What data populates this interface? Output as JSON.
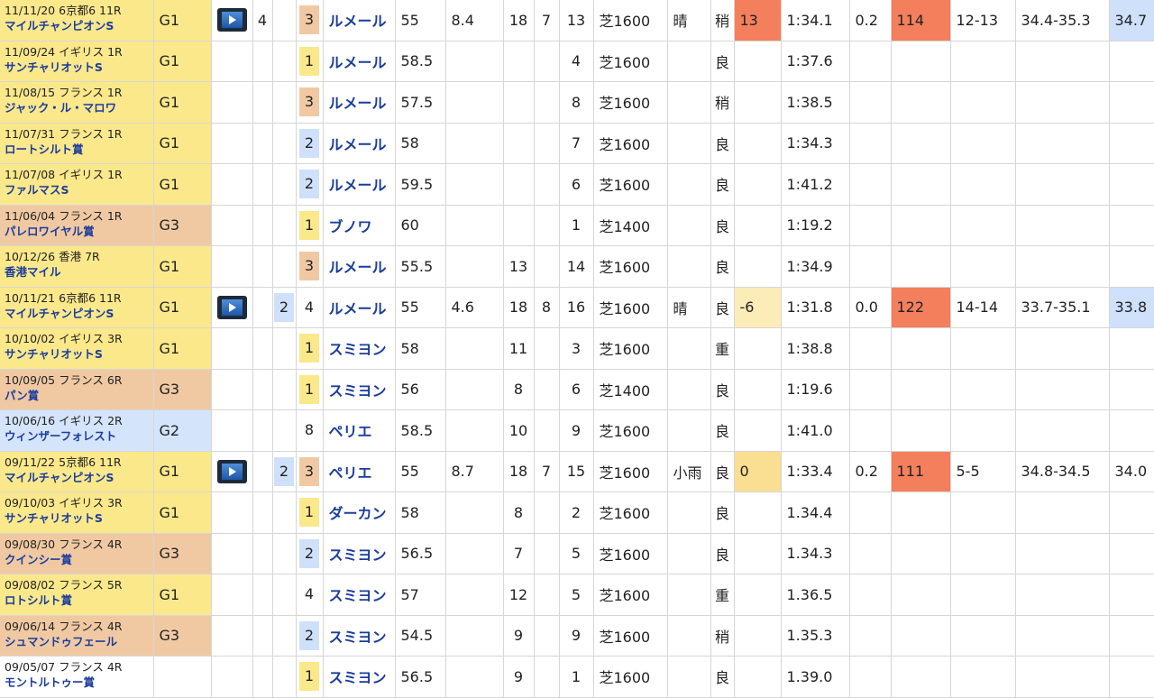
{
  "rows": [
    {
      "date": "11/11/20 6京都6 11R",
      "race": "マイルチャンピオンS",
      "grade": "G1",
      "grade_cls": "g1",
      "video": true,
      "gate": "4",
      "waku": "",
      "place": "3",
      "place_cls": "b3",
      "jockey": "ルメール",
      "weight": "55",
      "odds": "8.4",
      "field": "18",
      "pop": "7",
      "horse": "13",
      "course": "芝1600",
      "weather": "晴",
      "track": "稍",
      "diff": "13",
      "diff_cls": "diff-o",
      "time": "1:34.1",
      "margin": "0.2",
      "speed": "114",
      "pos": "12-13",
      "pace": "34.4-35.3",
      "last": "34.7",
      "last_cls": "last-b"
    },
    {
      "date": "11/09/24 イギリス 1R",
      "race": "サンチャリオットS",
      "grade": "G1",
      "grade_cls": "g1",
      "video": false,
      "gate": "",
      "waku": "",
      "place": "1",
      "place_cls": "b1",
      "jockey": "ルメール",
      "weight": "58.5",
      "odds": "",
      "field": "",
      "pop": "",
      "horse": "4",
      "course": "芝1600",
      "weather": "",
      "track": "良",
      "diff": "",
      "diff_cls": "",
      "time": "1:37.6",
      "margin": "",
      "speed": "",
      "pos": "",
      "pace": "",
      "last": "",
      "last_cls": ""
    },
    {
      "date": "11/08/15 フランス 1R",
      "race": "ジャック・ル・マロワ",
      "grade": "G1",
      "grade_cls": "g1",
      "video": false,
      "gate": "",
      "waku": "",
      "place": "3",
      "place_cls": "b3",
      "jockey": "ルメール",
      "weight": "57.5",
      "odds": "",
      "field": "",
      "pop": "",
      "horse": "8",
      "course": "芝1600",
      "weather": "",
      "track": "稍",
      "diff": "",
      "diff_cls": "",
      "time": "1:38.5",
      "margin": "",
      "speed": "",
      "pos": "",
      "pace": "",
      "last": "",
      "last_cls": ""
    },
    {
      "date": "11/07/31 フランス 1R",
      "race": "ロートシルト賞",
      "grade": "G1",
      "grade_cls": "g1",
      "video": false,
      "gate": "",
      "waku": "",
      "place": "2",
      "place_cls": "b2",
      "jockey": "ルメール",
      "weight": "58",
      "odds": "",
      "field": "",
      "pop": "",
      "horse": "7",
      "course": "芝1600",
      "weather": "",
      "track": "良",
      "diff": "",
      "diff_cls": "",
      "time": "1:34.3",
      "margin": "",
      "speed": "",
      "pos": "",
      "pace": "",
      "last": "",
      "last_cls": ""
    },
    {
      "date": "11/07/08 イギリス 1R",
      "race": "ファルマスS",
      "grade": "G1",
      "grade_cls": "g1",
      "video": false,
      "gate": "",
      "waku": "",
      "place": "2",
      "place_cls": "b2",
      "jockey": "ルメール",
      "weight": "59.5",
      "odds": "",
      "field": "",
      "pop": "",
      "horse": "6",
      "course": "芝1600",
      "weather": "",
      "track": "良",
      "diff": "",
      "diff_cls": "",
      "time": "1:41.2",
      "margin": "",
      "speed": "",
      "pos": "",
      "pace": "",
      "last": "",
      "last_cls": ""
    },
    {
      "date": "11/06/04 フランス 1R",
      "race": "パレロワイヤル賞",
      "grade": "G3",
      "grade_cls": "g3",
      "video": false,
      "gate": "",
      "waku": "",
      "place": "1",
      "place_cls": "b1",
      "jockey": "ブノワ",
      "weight": "60",
      "odds": "",
      "field": "",
      "pop": "",
      "horse": "1",
      "course": "芝1400",
      "weather": "",
      "track": "良",
      "diff": "",
      "diff_cls": "",
      "time": "1:19.2",
      "margin": "",
      "speed": "",
      "pos": "",
      "pace": "",
      "last": "",
      "last_cls": ""
    },
    {
      "date": "10/12/26 香港 7R",
      "race": "香港マイル",
      "grade": "G1",
      "grade_cls": "g1",
      "video": false,
      "gate": "",
      "waku": "",
      "place": "3",
      "place_cls": "b3",
      "jockey": "ルメール",
      "weight": "55.5",
      "odds": "",
      "field": "13",
      "pop": "",
      "horse": "14",
      "course": "芝1600",
      "weather": "",
      "track": "良",
      "diff": "",
      "diff_cls": "",
      "time": "1:34.9",
      "margin": "",
      "speed": "",
      "pos": "",
      "pace": "",
      "last": "",
      "last_cls": ""
    },
    {
      "date": "10/11/21 6京都6 11R",
      "race": "マイルチャンピオンS",
      "grade": "G1",
      "grade_cls": "g1",
      "video": true,
      "gate": "",
      "waku": "2",
      "place": "4",
      "place_cls": "",
      "jockey": "ルメール",
      "weight": "55",
      "odds": "4.6",
      "field": "18",
      "pop": "8",
      "horse": "16",
      "course": "芝1600",
      "weather": "晴",
      "track": "良",
      "diff": "-6",
      "diff_cls": "diff-y",
      "time": "1:31.8",
      "margin": "0.0",
      "speed": "122",
      "pos": "14-14",
      "pace": "33.7-35.1",
      "last": "33.8",
      "last_cls": "last-b"
    },
    {
      "date": "10/10/02 イギリス 3R",
      "race": "サンチャリオットS",
      "grade": "G1",
      "grade_cls": "g1",
      "video": false,
      "gate": "",
      "waku": "",
      "place": "1",
      "place_cls": "b1",
      "jockey": "スミヨン",
      "weight": "58",
      "odds": "",
      "field": "11",
      "pop": "",
      "horse": "3",
      "course": "芝1600",
      "weather": "",
      "track": "重",
      "diff": "",
      "diff_cls": "",
      "time": "1:38.8",
      "margin": "",
      "speed": "",
      "pos": "",
      "pace": "",
      "last": "",
      "last_cls": ""
    },
    {
      "date": "10/09/05 フランス 6R",
      "race": "パン賞",
      "grade": "G3",
      "grade_cls": "g3",
      "video": false,
      "gate": "",
      "waku": "",
      "place": "1",
      "place_cls": "b1",
      "jockey": "スミヨン",
      "weight": "56",
      "odds": "",
      "field": "8",
      "pop": "",
      "horse": "6",
      "course": "芝1400",
      "weather": "",
      "track": "良",
      "diff": "",
      "diff_cls": "",
      "time": "1:19.6",
      "margin": "",
      "speed": "",
      "pos": "",
      "pace": "",
      "last": "",
      "last_cls": ""
    },
    {
      "date": "10/06/16 イギリス 2R",
      "race": "ウィンザーフォレスト",
      "grade": "G2",
      "grade_cls": "g2",
      "video": false,
      "gate": "",
      "waku": "",
      "place": "8",
      "place_cls": "",
      "jockey": "ペリエ",
      "weight": "58.5",
      "odds": "",
      "field": "10",
      "pop": "",
      "horse": "9",
      "course": "芝1600",
      "weather": "",
      "track": "良",
      "diff": "",
      "diff_cls": "",
      "time": "1:41.0",
      "margin": "",
      "speed": "",
      "pos": "",
      "pace": "",
      "last": "",
      "last_cls": ""
    },
    {
      "date": "09/11/22 5京都6 11R",
      "race": "マイルチャンピオンS",
      "grade": "G1",
      "grade_cls": "g1",
      "video": true,
      "gate": "",
      "waku": "2",
      "place": "3",
      "place_cls": "b3",
      "jockey": "ペリエ",
      "weight": "55",
      "odds": "8.7",
      "field": "18",
      "pop": "7",
      "horse": "15",
      "course": "芝1600",
      "weather": "小雨",
      "track": "良",
      "diff": "0",
      "diff_cls": "diff-g",
      "time": "1:33.4",
      "margin": "0.2",
      "speed": "111",
      "pos": "5-5",
      "pace": "34.8-34.5",
      "last": "34.0",
      "last_cls": ""
    },
    {
      "date": "09/10/03 イギリス 3R",
      "race": "サンチャリオットS",
      "grade": "G1",
      "grade_cls": "g1",
      "video": false,
      "gate": "",
      "waku": "",
      "place": "1",
      "place_cls": "b1",
      "jockey": "ダーカン",
      "weight": "58",
      "odds": "",
      "field": "8",
      "pop": "",
      "horse": "2",
      "course": "芝1600",
      "weather": "",
      "track": "良",
      "diff": "",
      "diff_cls": "",
      "time": "1.34.4",
      "margin": "",
      "speed": "",
      "pos": "",
      "pace": "",
      "last": "",
      "last_cls": ""
    },
    {
      "date": "09/08/30 フランス 4R",
      "race": "クインシー賞",
      "grade": "G3",
      "grade_cls": "g3",
      "video": false,
      "gate": "",
      "waku": "",
      "place": "2",
      "place_cls": "b2",
      "jockey": "スミヨン",
      "weight": "56.5",
      "odds": "",
      "field": "7",
      "pop": "",
      "horse": "5",
      "course": "芝1600",
      "weather": "",
      "track": "良",
      "diff": "",
      "diff_cls": "",
      "time": "1.34.3",
      "margin": "",
      "speed": "",
      "pos": "",
      "pace": "",
      "last": "",
      "last_cls": ""
    },
    {
      "date": "09/08/02 フランス 5R",
      "race": "ロトシルト賞",
      "grade": "G1",
      "grade_cls": "g1",
      "video": false,
      "gate": "",
      "waku": "",
      "place": "4",
      "place_cls": "",
      "jockey": "スミヨン",
      "weight": "57",
      "odds": "",
      "field": "12",
      "pop": "",
      "horse": "5",
      "course": "芝1600",
      "weather": "",
      "track": "重",
      "diff": "",
      "diff_cls": "",
      "time": "1.36.5",
      "margin": "",
      "speed": "",
      "pos": "",
      "pace": "",
      "last": "",
      "last_cls": ""
    },
    {
      "date": "09/06/14 フランス 4R",
      "race": "シュマンドゥフェール",
      "grade": "G3",
      "grade_cls": "g3",
      "video": false,
      "gate": "",
      "waku": "",
      "place": "2",
      "place_cls": "b2",
      "jockey": "スミヨン",
      "weight": "54.5",
      "odds": "",
      "field": "9",
      "pop": "",
      "horse": "9",
      "course": "芝1600",
      "weather": "",
      "track": "稍",
      "diff": "",
      "diff_cls": "",
      "time": "1.35.3",
      "margin": "",
      "speed": "",
      "pos": "",
      "pace": "",
      "last": "",
      "last_cls": ""
    },
    {
      "date": "09/05/07 フランス 4R",
      "race": "モントルトゥー賞",
      "grade": "",
      "grade_cls": "",
      "video": false,
      "gate": "",
      "waku": "",
      "place": "1",
      "place_cls": "b1",
      "jockey": "スミヨン",
      "weight": "56.5",
      "odds": "",
      "field": "9",
      "pop": "",
      "horse": "1",
      "course": "芝1600",
      "weather": "",
      "track": "良",
      "diff": "",
      "diff_cls": "",
      "time": "1.39.0",
      "margin": "",
      "speed": "",
      "pos": "",
      "pace": "",
      "last": "",
      "last_cls": ""
    }
  ]
}
